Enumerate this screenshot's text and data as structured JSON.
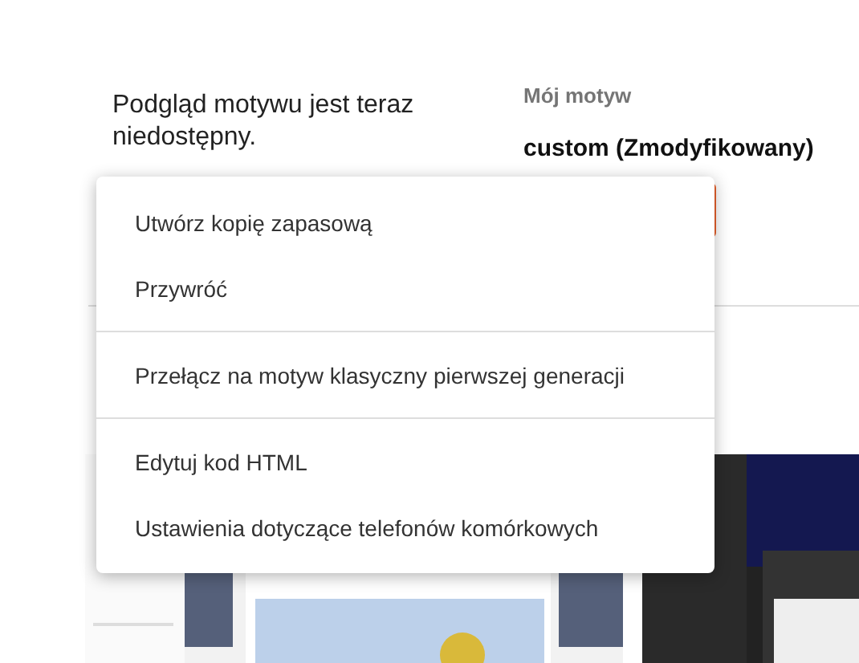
{
  "preview": {
    "message": "Podgląd motywu jest teraz niedostępny."
  },
  "my_theme": {
    "label": "Mój motyw",
    "name": "custom (Zmodyfikowany)"
  },
  "menu": {
    "groups": [
      {
        "items": [
          "Utwórz kopię zapasową",
          "Przywróć"
        ]
      },
      {
        "items": [
          "Przełącz na motyw klasyczny pierwszej generacji"
        ]
      },
      {
        "items": [
          "Edytuj kod HTML",
          "Ustawienia dotyczące telefonów komórkowych"
        ]
      }
    ]
  }
}
